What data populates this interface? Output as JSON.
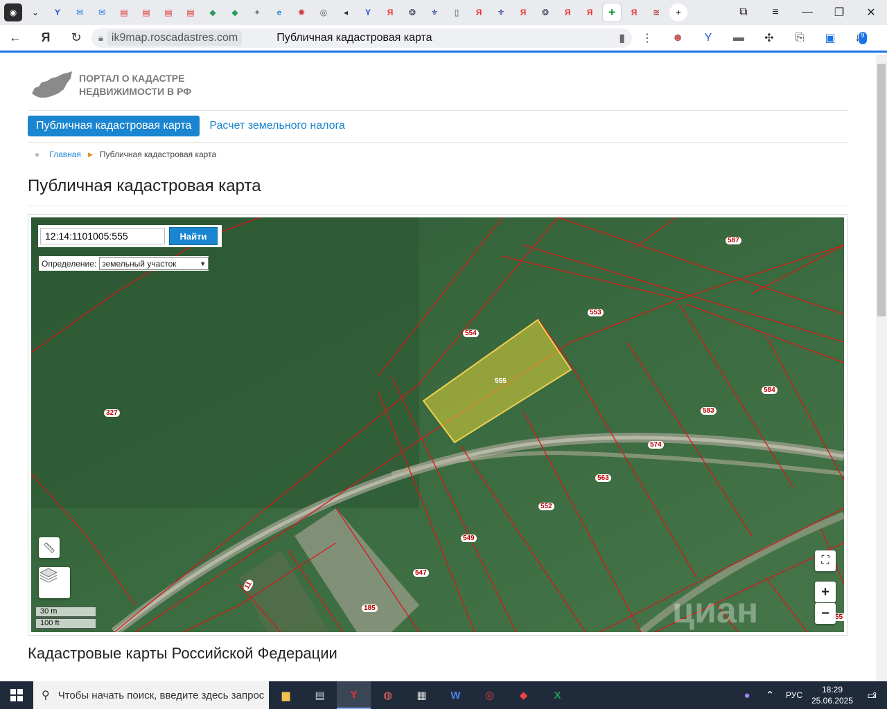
{
  "browser": {
    "url_host": "ik9map.roscadastres.com",
    "tab_title": "Публичная кадастровая карта",
    "download_count": "9"
  },
  "site": {
    "logo_line1": "ПОРТАЛ О КАДАСТРЕ",
    "logo_line2": "НЕДВИЖИМОСТИ В РФ",
    "menu_active": "Публичная кадастровая карта",
    "menu_link": "Расчет земельного налога",
    "breadcrumb_home": "Главная",
    "breadcrumb_current": "Публичная кадастровая карта",
    "page_title": "Публичная кадастровая карта",
    "section_title": "Кадастровые карты Российской Федерации"
  },
  "map": {
    "search_value": "12:14:1101005:555",
    "search_button": "Найти",
    "definition_label": "Определение:",
    "definition_value": "земельный участок",
    "scale_m": "30 m",
    "scale_ft": "100 ft",
    "zoom_in": "+",
    "zoom_out": "−",
    "watermark": "циан",
    "parcel_labels": [
      "587",
      "553",
      "554",
      "555",
      "584",
      "583",
      "574",
      "327",
      "563",
      "552",
      "549",
      "547",
      "185",
      "11",
      "55"
    ],
    "highlight_color": "#e0d23a",
    "boundary_color": "#d81818"
  },
  "taskbar": {
    "search_placeholder": "Чтобы начать поиск, введите здесь запрос",
    "lang": "РУС",
    "time": "18:29",
    "date": "25.06.2025",
    "notifications": "2"
  }
}
